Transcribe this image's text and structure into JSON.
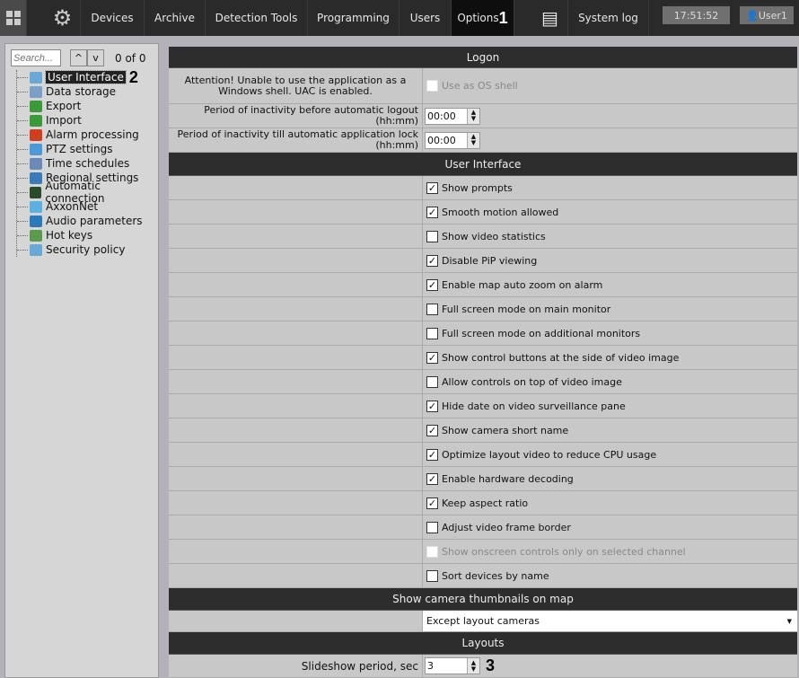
{
  "topbar": {
    "nav": [
      "Devices",
      "Archive",
      "Detection Tools",
      "Programming",
      "Users",
      "Options"
    ],
    "options_marker": "1",
    "system_log": "System log",
    "clock": "17:51:52",
    "user": "User1"
  },
  "sidebar": {
    "search_placeholder": "Search...",
    "count": "0 of 0",
    "selected_marker": "2",
    "items": [
      {
        "label": "User Interface",
        "color": "#6aa8d8"
      },
      {
        "label": "Data storage",
        "color": "#7aa0c8"
      },
      {
        "label": "Export",
        "color": "#3a9a3a"
      },
      {
        "label": "Import",
        "color": "#3a9a3a"
      },
      {
        "label": "Alarm processing",
        "color": "#d04020"
      },
      {
        "label": "PTZ settings",
        "color": "#4a9ad8"
      },
      {
        "label": "Time schedules",
        "color": "#6a8ab8"
      },
      {
        "label": "Regional settings",
        "color": "#3a7ab8"
      },
      {
        "label": "Automatic connection",
        "color": "#2a4a2a"
      },
      {
        "label": "AxxonNet",
        "color": "#5ab0e0"
      },
      {
        "label": "Audio parameters",
        "color": "#2a7ab8"
      },
      {
        "label": "Hot keys",
        "color": "#5a9a4a"
      },
      {
        "label": "Security policy",
        "color": "#6aa8d8"
      }
    ]
  },
  "logon": {
    "title": "Logon",
    "attention": "Attention! Unable to use the application as a Windows shell. UAC is enabled.",
    "os_shell": "Use as OS shell",
    "logout_label": "Period of inactivity before automatic logout (hh:mm)",
    "logout_value": "00:00",
    "lock_label": "Period of inactivity till automatic application lock (hh:mm)",
    "lock_value": "00:00"
  },
  "ui": {
    "title": "User Interface",
    "options": [
      {
        "label": "Show prompts",
        "checked": true
      },
      {
        "label": "Smooth motion allowed",
        "checked": true
      },
      {
        "label": "Show video statistics",
        "checked": false
      },
      {
        "label": "Disable PiP viewing",
        "checked": true
      },
      {
        "label": "Enable map auto zoom on alarm",
        "checked": true
      },
      {
        "label": "Full screen mode on main monitor",
        "checked": false
      },
      {
        "label": "Full screen mode on additional monitors",
        "checked": false
      },
      {
        "label": "Show control buttons at the side of video image",
        "checked": true
      },
      {
        "label": "Allow controls on top of video image",
        "checked": false
      },
      {
        "label": "Hide date on video surveillance pane",
        "checked": true
      },
      {
        "label": "Show camera short name",
        "checked": true
      },
      {
        "label": "Optimize layout video to reduce CPU usage",
        "checked": true
      },
      {
        "label": "Enable hardware decoding",
        "checked": true
      },
      {
        "label": "Keep aspect ratio",
        "checked": true
      },
      {
        "label": "Adjust video frame border",
        "checked": false
      },
      {
        "label": "Show onscreen controls only on selected channel",
        "checked": false,
        "disabled": true
      },
      {
        "label": "Sort devices by name",
        "checked": false
      }
    ]
  },
  "thumbs": {
    "title": "Show camera thumbnails on map",
    "value": "Except layout cameras"
  },
  "layouts": {
    "title": "Layouts",
    "slideshow_label": "Slideshow period, sec",
    "slideshow_value": "3",
    "marker": "3"
  }
}
